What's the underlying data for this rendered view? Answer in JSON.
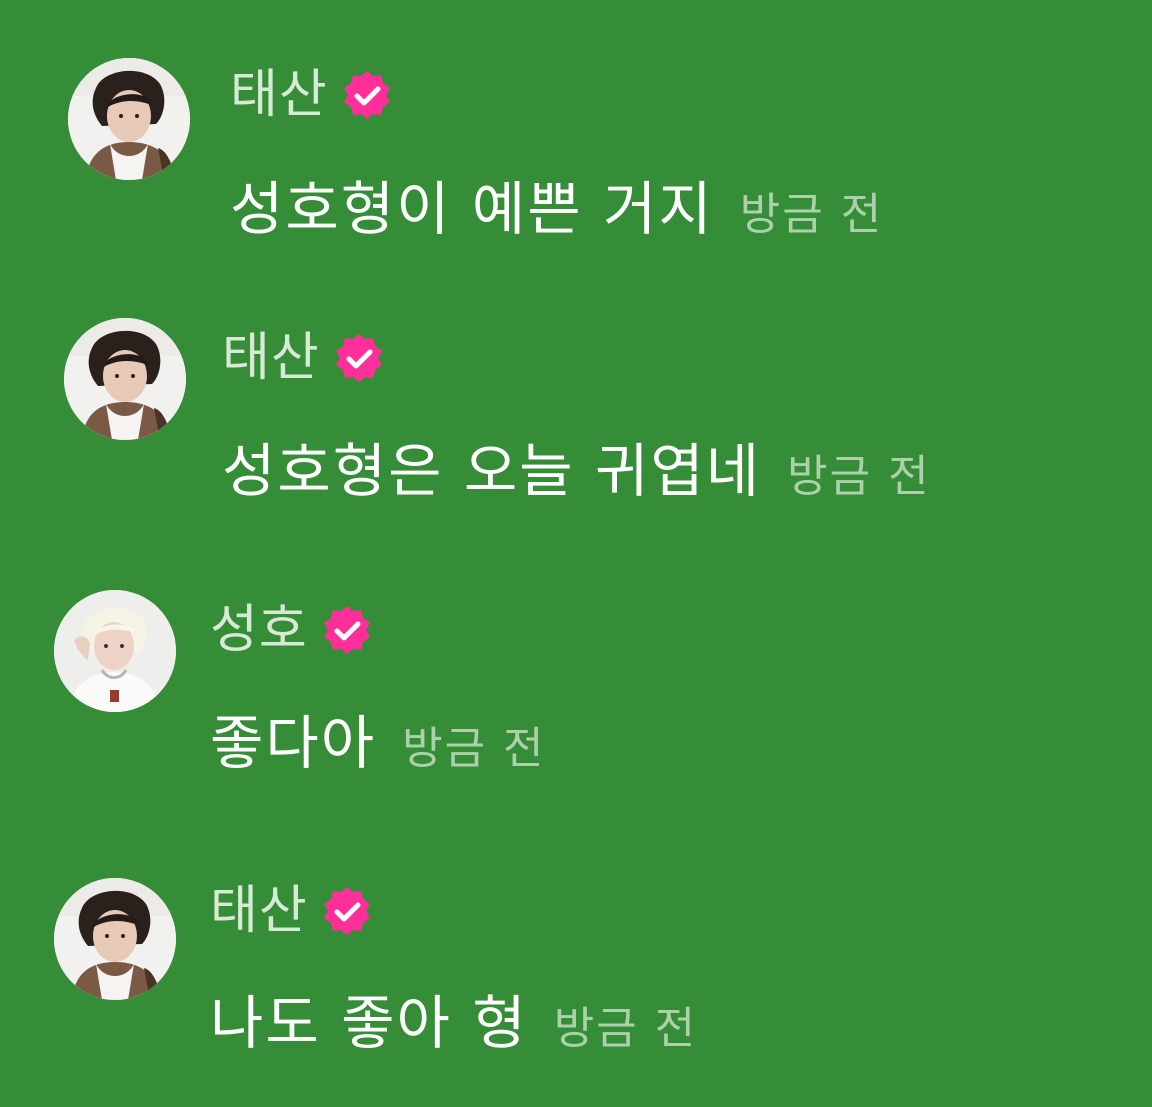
{
  "messages": [
    {
      "author": "태산",
      "text": "성호형이 예쁜 거지",
      "time": "방금 전"
    },
    {
      "author": "태산",
      "text": "성호형은 오늘 귀엽네",
      "time": "방금 전"
    },
    {
      "author": "성호",
      "text": "좋다아",
      "time": "방금 전"
    },
    {
      "author": "태산",
      "text": "나도 좋아 형",
      "time": "방금 전"
    }
  ],
  "colors": {
    "background": "#368d37",
    "badge": "#ff2f9a",
    "author": "#d8e9d6",
    "text": "#ffffff",
    "time": "#acd0aa"
  },
  "icons": {
    "badge": "verified-badge-icon"
  }
}
